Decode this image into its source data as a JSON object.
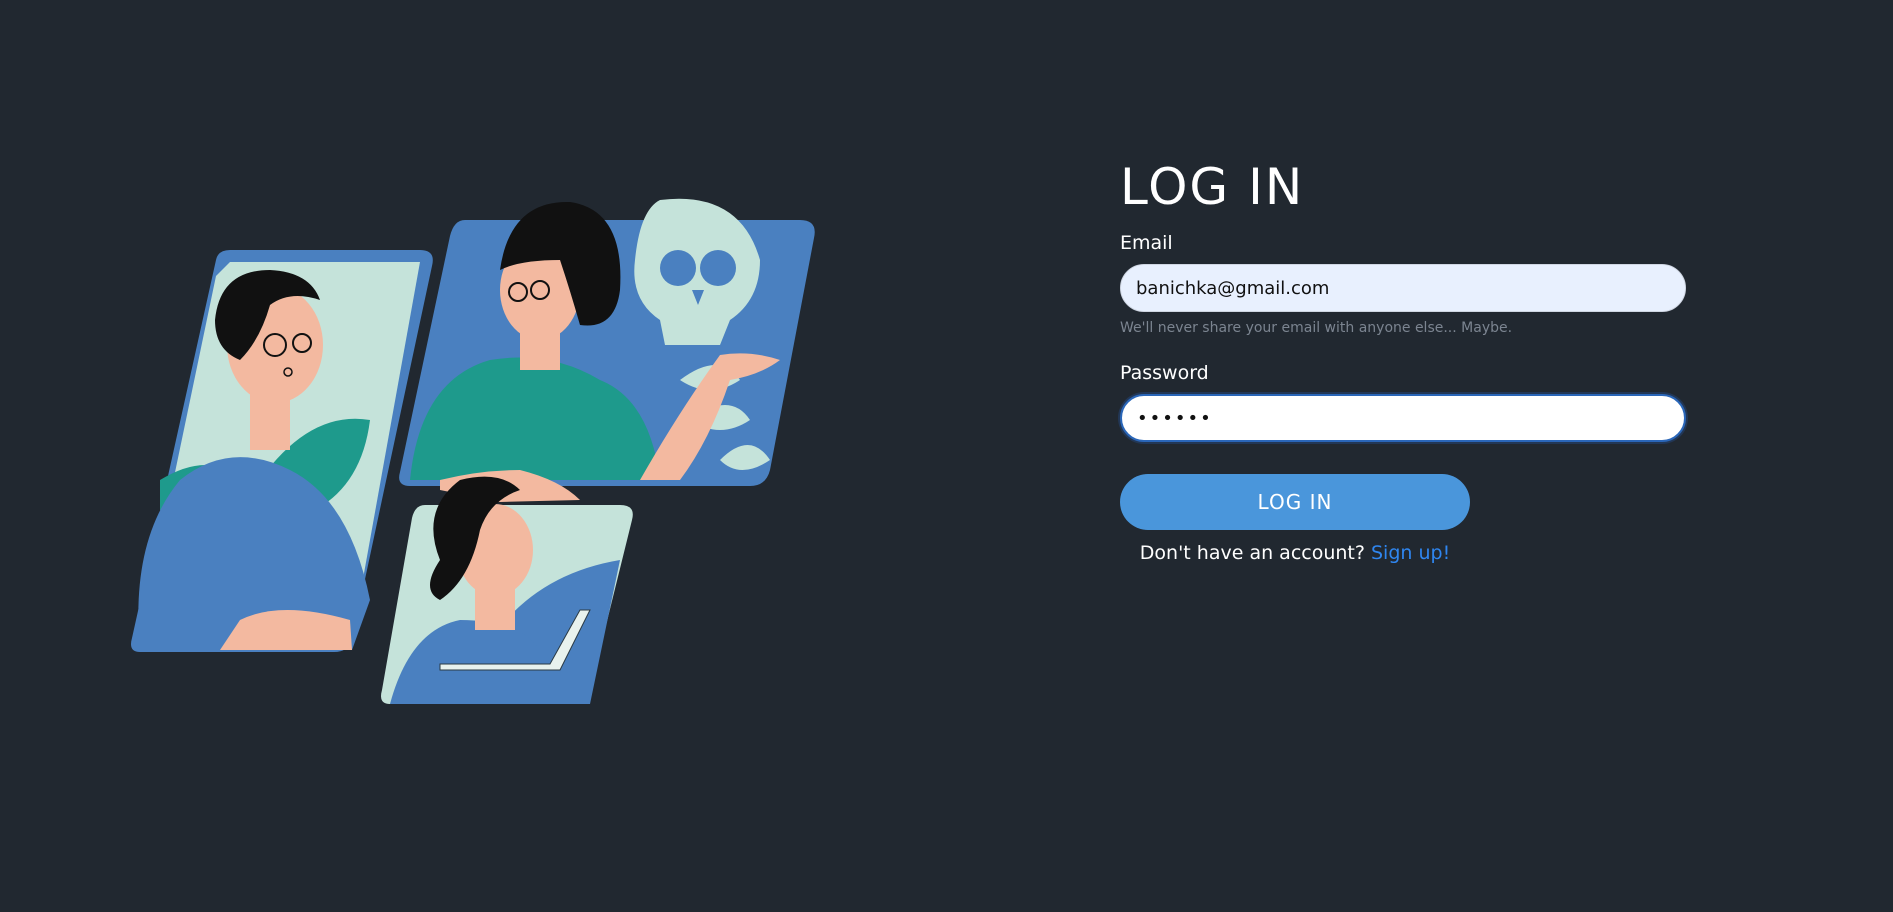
{
  "login": {
    "title": "LOG IN",
    "email_label": "Email",
    "email_value": "banichka@gmail.com",
    "email_hint": "We'll never share your email with anyone else... Maybe.",
    "password_label": "Password",
    "password_value": "••••••",
    "submit_label": "LOG IN",
    "signup_prompt": "Don't have an account?",
    "signup_link": "Sign up!"
  },
  "colors": {
    "background": "#212830",
    "accent_button": "#4a96db",
    "link": "#2f86f0",
    "panel_blue": "#4a80c0",
    "panel_mint": "#c5e3da",
    "teal": "#1e9a8c",
    "skin": "#f3b9a0"
  },
  "illustration": {
    "icon": "people-video-call-illustration"
  }
}
